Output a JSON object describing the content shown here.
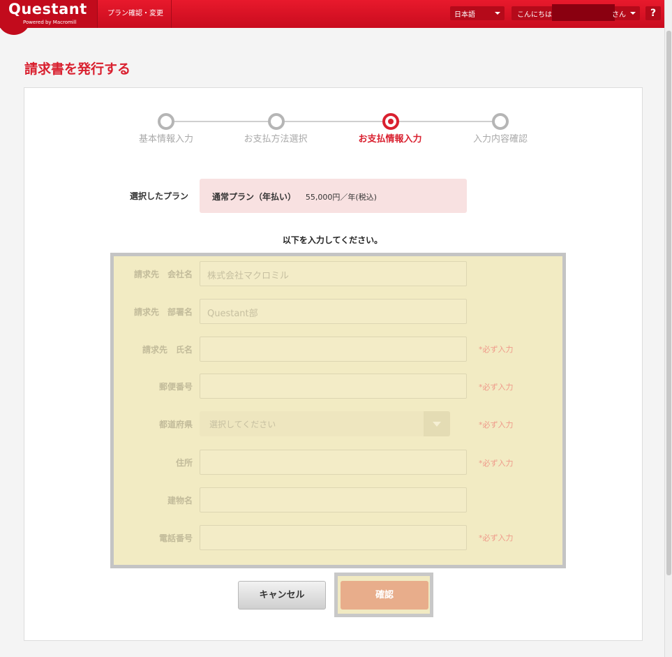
{
  "header": {
    "logo": "Questant",
    "logo_sub": "Powered by Macromill",
    "nav_plan": "プラン確認・変更",
    "language": "日本語",
    "greeting": "こんにちは",
    "greeting_suffix": "さん",
    "help": "?"
  },
  "page_title": "請求書を発行する",
  "steps": [
    {
      "label": "基本情報入力",
      "state": "done"
    },
    {
      "label": "お支払方法選択",
      "state": "done"
    },
    {
      "label": "お支払情報入力",
      "state": "active"
    },
    {
      "label": "入力内容確認",
      "state": "pending"
    }
  ],
  "plan": {
    "label": "選択したプラン",
    "name": "通常プラン（年払い）",
    "price": "55,000円／年(税込)"
  },
  "instruction": "以下を入力してください。",
  "form": {
    "company_label": "請求先　会社名",
    "company_value": "株式会社マクロミル",
    "department_label": "請求先　部署名",
    "department_value": "Questant部",
    "name_label": "請求先　氏名",
    "postal_label": "郵便番号",
    "prefecture_label": "都道府県",
    "prefecture_placeholder": "選択してください",
    "address_label": "住所",
    "building_label": "建物名",
    "phone_label": "電話番号",
    "required_text": "*必ず入力"
  },
  "buttons": {
    "cancel": "キャンセル",
    "confirm": "確認"
  }
}
